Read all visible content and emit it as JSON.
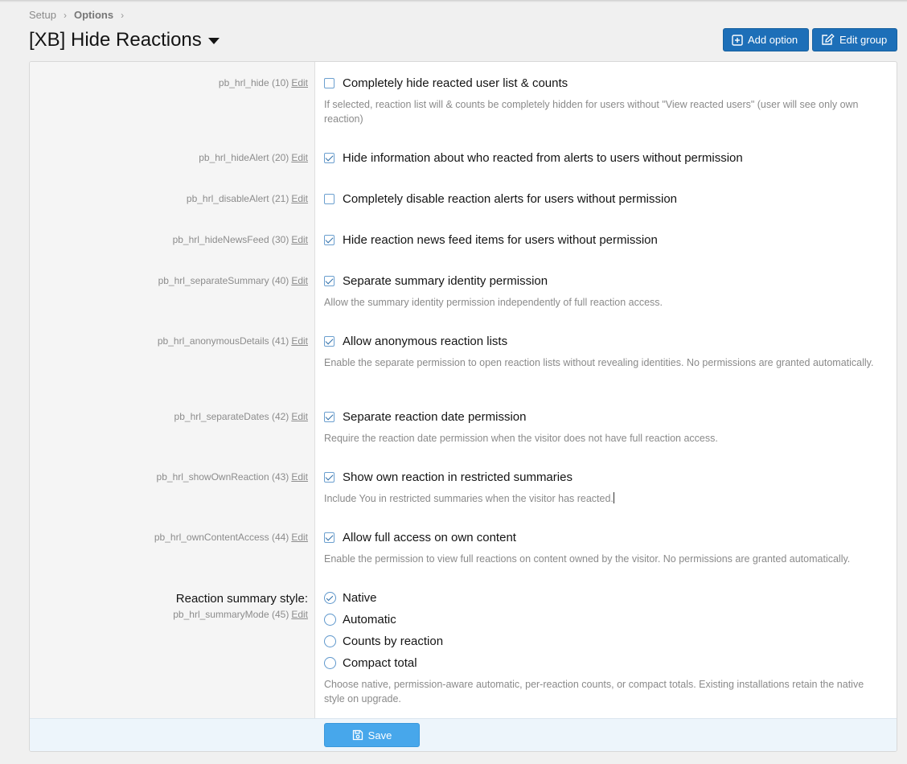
{
  "breadcrumb": {
    "items": [
      "Setup",
      "Options"
    ]
  },
  "page": {
    "title": "[XB] Hide Reactions"
  },
  "header_buttons": {
    "add_option": "Add option",
    "edit_group": "Edit group"
  },
  "edit_label": "Edit",
  "options": [
    {
      "id": "pb_hrl_hide (10)",
      "label": "Completely hide reacted user list & counts",
      "checked": false,
      "hint": "If selected, reaction list will & counts be completely hidden for users without \"View reacted users\" (user will see only own reaction)"
    },
    {
      "id": "pb_hrl_hideAlert (20)",
      "label": "Hide information about who reacted from alerts to users without permission",
      "checked": true,
      "hint": ""
    },
    {
      "id": "pb_hrl_disableAlert (21)",
      "label": "Completely disable reaction alerts for users without permission",
      "checked": false,
      "hint": ""
    },
    {
      "id": "pb_hrl_hideNewsFeed (30)",
      "label": "Hide reaction news feed items for users without permission",
      "checked": true,
      "hint": ""
    },
    {
      "id": "pb_hrl_separateSummary (40)",
      "label": "Separate summary identity permission",
      "checked": true,
      "hint": "Allow the summary identity permission independently of full reaction access."
    },
    {
      "id": "pb_hrl_anonymousDetails (41)",
      "label": "Allow anonymous reaction lists",
      "checked": true,
      "hint": "Enable the separate permission to open reaction lists without revealing identities. No permissions are granted automatically."
    },
    {
      "id": "pb_hrl_separateDates (42)",
      "label": "Separate reaction date permission",
      "checked": true,
      "hint": "Require the reaction date permission when the visitor does not have full reaction access."
    },
    {
      "id": "pb_hrl_showOwnReaction (43)",
      "label": "Show own reaction in restricted summaries",
      "checked": true,
      "hint": "Include You in restricted summaries when the visitor has reacted."
    },
    {
      "id": "pb_hrl_ownContentAccess (44)",
      "label": "Allow full access on own content",
      "checked": true,
      "hint": "Enable the permission to view full reactions on content owned by the visitor. No permissions are granted automatically."
    }
  ],
  "summary_style": {
    "label": "Reaction summary style:",
    "id": "pb_hrl_summaryMode (45)",
    "choices": [
      "Native",
      "Automatic",
      "Counts by reaction",
      "Compact total"
    ],
    "selected": "Native",
    "hint": "Choose native, permission-aware automatic, per-reaction counts, or compact totals. Existing installations retain the native style on upgrade."
  },
  "footer": {
    "save_label": "Save"
  },
  "colors": {
    "primary_button": "#1d6fb8",
    "save_button": "#47a7eb",
    "checkbox": "#2f6ea8"
  },
  "icons": {
    "add": "plus-square-icon",
    "edit": "pencil-square-icon",
    "save": "floppy-disk-icon",
    "breadcrumb_sep": "chevron-right-icon"
  }
}
